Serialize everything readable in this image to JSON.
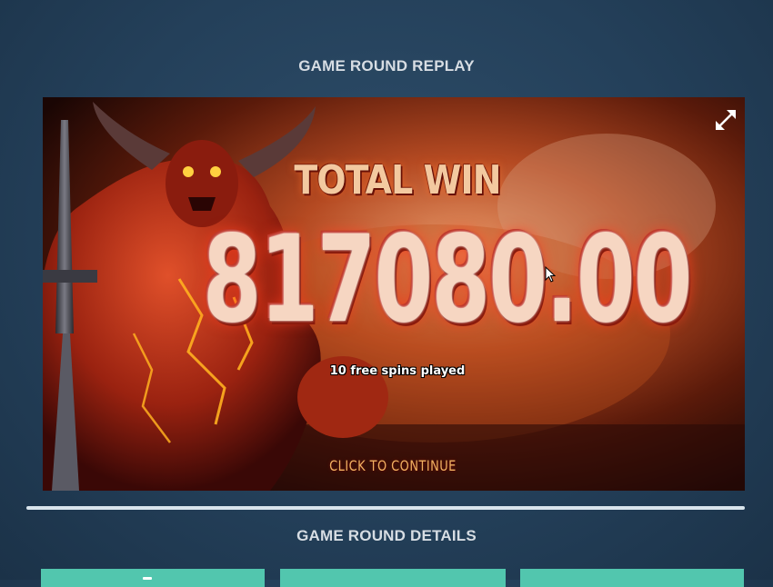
{
  "replay": {
    "title": "GAME ROUND REPLAY"
  },
  "game": {
    "total_win_label": "TOTAL WIN",
    "win_amount": "817080.00",
    "spins_played": "10 free spins played",
    "continue_label": "CLICK TO CONTINUE",
    "fullscreen_icon": "expand-arrows-icon",
    "character_icon": "horned-demon-with-sword"
  },
  "details": {
    "title": "GAME ROUND DETAILS"
  },
  "colors": {
    "page_bg": "#24405a",
    "heading_text": "#d7dde3",
    "win_text": "#f6d6c2",
    "continue_text": "#f0b060",
    "card_accent": "#52c6ae"
  }
}
